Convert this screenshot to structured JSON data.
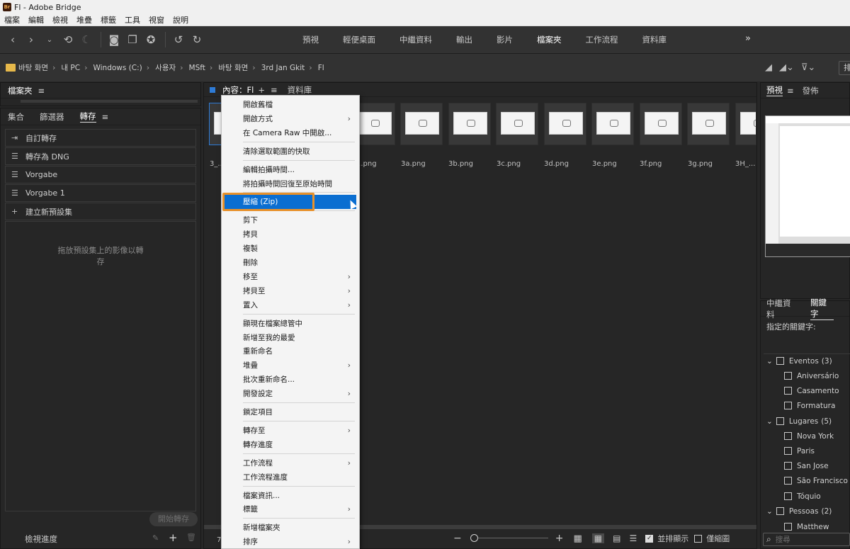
{
  "window": {
    "title": "Fl - Adobe Bridge",
    "app_badge": "Br"
  },
  "menubar": [
    "檔案",
    "編輯",
    "檢視",
    "堆疊",
    "標籤",
    "工具",
    "視窗",
    "說明"
  ],
  "workspaces": [
    "預視",
    "輕便桌面",
    "中繼資料",
    "輸出",
    "影片",
    "檔案夾",
    "工作流程",
    "資料庫"
  ],
  "active_workspace": "檔案夾",
  "more_workspaces": "»",
  "breadcrumb": [
    "바탕 화면",
    "내 PC",
    "Windows (C:)",
    "사용자",
    "MSft",
    "바탕 화면",
    "3rd Jan Gkit",
    "Fl"
  ],
  "topright_label": "排",
  "folders_panel": {
    "title": "檔案夾",
    "menu": "≡"
  },
  "left_tabs": [
    "集合",
    "篩選器",
    "轉存"
  ],
  "left_active_tab": "轉存",
  "export_items": [
    {
      "icon": "export-arrow-icon",
      "label": "自訂轉存"
    },
    {
      "icon": "list-icon",
      "label": "轉存為 DNG"
    },
    {
      "icon": "list-icon",
      "label": "Vorgabe"
    },
    {
      "icon": "list-icon",
      "label": "Vorgabe 1"
    },
    {
      "icon": "plus-icon",
      "label": "建立新預設集"
    }
  ],
  "drop_hint_line1": "拖放預設集上的影像以轉",
  "drop_hint_line2": "存",
  "start_export": "開始轉存",
  "view_progress": "檢視進度",
  "content_panel": {
    "title": "內容：Fl",
    "tab2": "資料庫"
  },
  "thumbnails": [
    {
      "label": "3_..."
    },
    {
      "label": "...png"
    },
    {
      "label": "3a.png"
    },
    {
      "label": "3b.png"
    },
    {
      "label": "3c.png"
    },
    {
      "label": "3d.png"
    },
    {
      "label": "3e.png"
    },
    {
      "label": "3f.png"
    },
    {
      "label": "3g.png"
    },
    {
      "label": "3H_..."
    }
  ],
  "bottom_bar": {
    "count": "7",
    "minus": "−",
    "plus": "+",
    "stack_label": "並排顯示",
    "thumb_only_label": "僅縮圖"
  },
  "context_menu": [
    {
      "label": "開啟舊檔",
      "arrow": false
    },
    {
      "label": "開啟方式",
      "arrow": true
    },
    {
      "label": "在 Camera Raw 中開啟...",
      "arrow": false
    },
    {
      "sep": true
    },
    {
      "label": "清除選取範圍的快取",
      "arrow": false
    },
    {
      "sep": true
    },
    {
      "label": "編輯拍攝時間...",
      "arrow": false
    },
    {
      "label": "將拍攝時間回復至原始時間",
      "arrow": false
    },
    {
      "sep": true
    },
    {
      "label": "壓縮 (Zip)",
      "arrow": false,
      "highlighted": true
    },
    {
      "sep": true
    },
    {
      "label": "剪下",
      "arrow": false
    },
    {
      "label": "拷貝",
      "arrow": false
    },
    {
      "label": "複製",
      "arrow": false
    },
    {
      "label": "刪除",
      "arrow": false
    },
    {
      "label": "移至",
      "arrow": true
    },
    {
      "label": "拷貝至",
      "arrow": true
    },
    {
      "label": "置入",
      "arrow": true
    },
    {
      "sep": true
    },
    {
      "label": "顯現在檔案總管中",
      "arrow": false
    },
    {
      "label": "新增至我的最愛",
      "arrow": false
    },
    {
      "label": "重新命名",
      "arrow": false
    },
    {
      "label": "堆疊",
      "arrow": true
    },
    {
      "label": "批次重新命名...",
      "arrow": false
    },
    {
      "label": "開發設定",
      "arrow": true
    },
    {
      "sep": true
    },
    {
      "label": "鎖定項目",
      "arrow": false
    },
    {
      "sep": true
    },
    {
      "label": "轉存至",
      "arrow": true
    },
    {
      "label": "轉存進度",
      "arrow": false
    },
    {
      "sep": true
    },
    {
      "label": "工作流程",
      "arrow": true
    },
    {
      "label": "工作流程進度",
      "arrow": false
    },
    {
      "sep": true
    },
    {
      "label": "檔案資訊...",
      "arrow": false
    },
    {
      "label": "標籤",
      "arrow": true
    },
    {
      "sep": true
    },
    {
      "label": "新增檔案夾",
      "arrow": false
    },
    {
      "label": "排序",
      "arrow": true
    }
  ],
  "preview_tabs": [
    "預視",
    "發佈"
  ],
  "metadata_tabs": [
    "中繼資料",
    "關鍵字"
  ],
  "assigned_keywords": "指定的關鍵字:",
  "keyword_groups": [
    {
      "name": "Eventos",
      "count": "(3)",
      "items": [
        "Aniversário",
        "Casamento",
        "Formatura"
      ]
    },
    {
      "name": "Lugares",
      "count": "(5)",
      "items": [
        "Nova York",
        "Paris",
        "San Jose",
        "São Francisco",
        "Tóquio"
      ]
    },
    {
      "name": "Pessoas",
      "count": "(2)",
      "items": [
        "Matthew"
      ]
    }
  ],
  "search_placeholder": "搜尋",
  "colors": {
    "highlight": "#0a6ed1",
    "callout": "#e8912a"
  }
}
